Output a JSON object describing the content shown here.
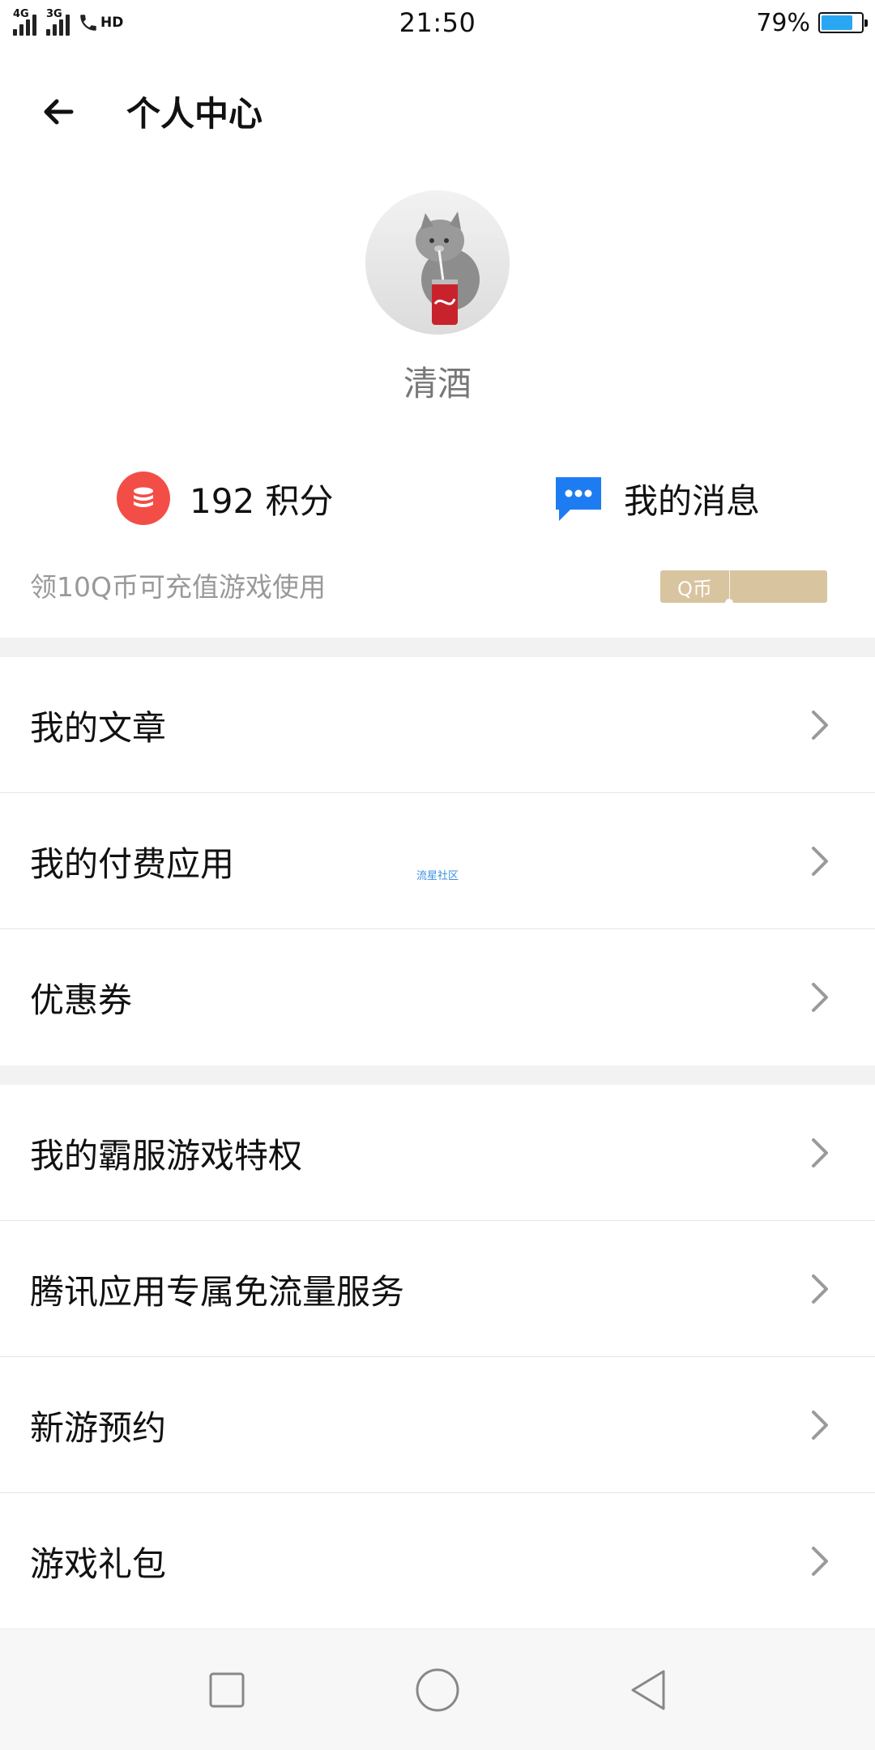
{
  "status_bar": {
    "signal1_label": "4G",
    "signal2_label": "3G",
    "hd_label": "HD",
    "time": "21:50",
    "battery_text": "79%",
    "battery_level": 0.79,
    "battery_color": "#2aa7f2"
  },
  "header": {
    "title": "个人中心",
    "back_icon": "arrow-left-icon"
  },
  "profile": {
    "username": "清酒",
    "avatar_desc": "avatar-image"
  },
  "stats": {
    "points_label": "192 积分",
    "points_icon": "coin-stack-icon",
    "points_color": "#f24e47",
    "messages_label": "我的消息",
    "messages_icon": "chat-bubble-icon",
    "messages_color": "#1e7cf2"
  },
  "promo": {
    "text": "领10Q币可充值游戏使用",
    "badge_label": "Q币",
    "badge_color": "#d9c4a0"
  },
  "group1": [
    {
      "label": "我的文章"
    },
    {
      "label": "我的付费应用"
    },
    {
      "label": "优惠券"
    }
  ],
  "group2": [
    {
      "label": "我的霸服游戏特权"
    },
    {
      "label": "腾讯应用专属免流量服务"
    },
    {
      "label": "新游预约"
    },
    {
      "label": "游戏礼包"
    }
  ],
  "watermark": "流星社区",
  "navbar": {
    "recent_icon": "square-icon",
    "home_icon": "circle-icon",
    "back_icon": "triangle-back-icon"
  }
}
